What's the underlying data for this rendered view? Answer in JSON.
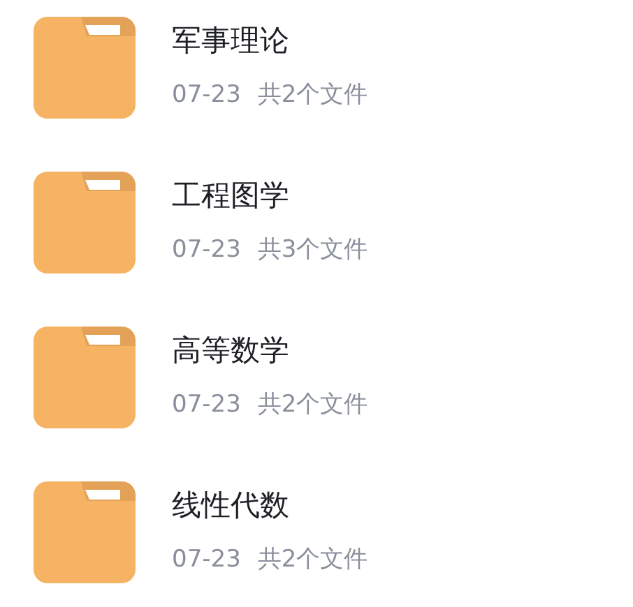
{
  "folders": [
    {
      "name": "军事理论",
      "date": "07-23",
      "count": "共2个文件"
    },
    {
      "name": "工程图学",
      "date": "07-23",
      "count": "共3个文件"
    },
    {
      "name": "高等数学",
      "date": "07-23",
      "count": "共2个文件"
    },
    {
      "name": "线性代数",
      "date": "07-23",
      "count": "共2个文件"
    }
  ]
}
